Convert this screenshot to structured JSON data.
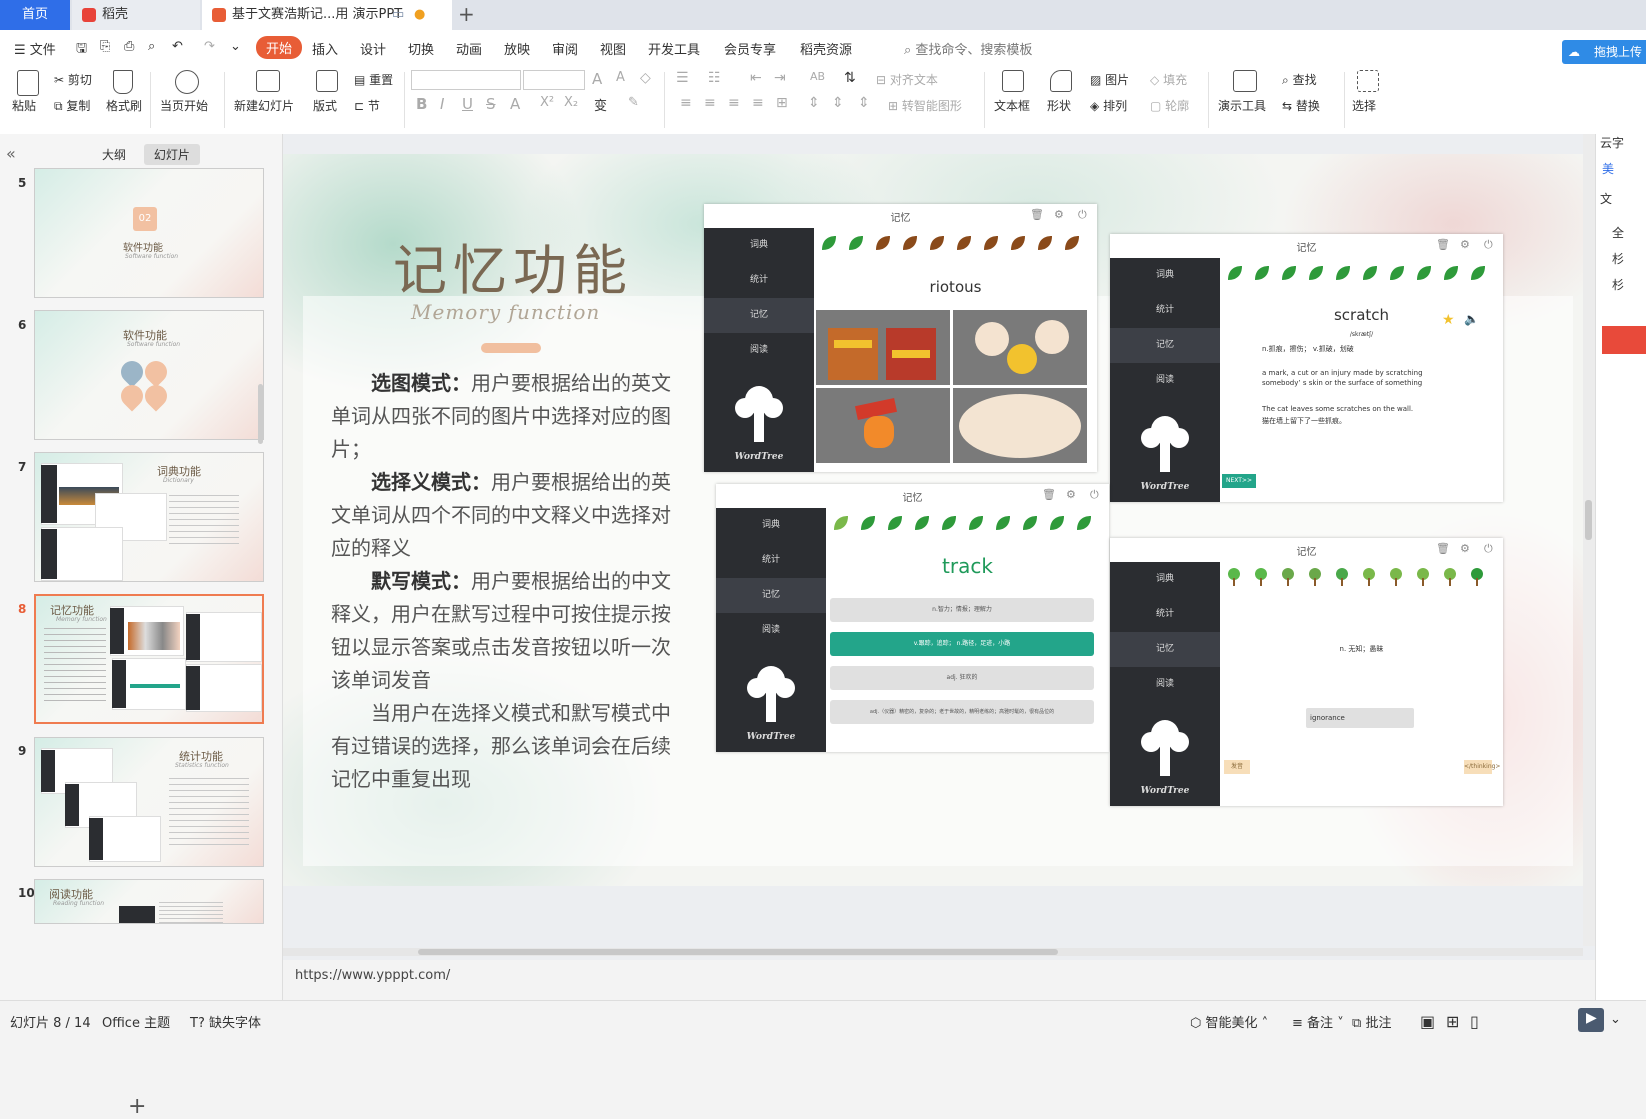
{
  "tabs": [
    {
      "label": "首页"
    },
    {
      "label": "稻壳"
    },
    {
      "label": "基于文赛浩斯记...用 演示PPT"
    }
  ],
  "menu": {
    "file": "文件",
    "items": [
      "开始",
      "插入",
      "设计",
      "切换",
      "动画",
      "放映",
      "审阅",
      "视图",
      "开发工具",
      "会员专享",
      "稻壳资源"
    ],
    "search": "查找命令、搜索模板",
    "cloud": "拖拽上传"
  },
  "ribbon": {
    "paste": "粘贴",
    "cut": "剪切",
    "copy": "复制",
    "format_painter": "格式刷",
    "from_current": "当页开始",
    "new_slide": "新建幻灯片",
    "layout": "版式",
    "reset": "重置",
    "section": "节",
    "align_text": "对齐文本",
    "smartart": "转智能图形",
    "textbox": "文本框",
    "shape": "形状",
    "picture": "图片",
    "arrange": "排列",
    "fill": "填充",
    "outline": "轮廓",
    "present_tools": "演示工具",
    "find": "查找",
    "replace": "替换",
    "select": "选择"
  },
  "leftpanel": {
    "tab_outline": "大纲",
    "tab_slides": "幻灯片",
    "thumbs": [
      {
        "num": "5",
        "title": "软件功能",
        "badge": "02",
        "sub": "Software function"
      },
      {
        "num": "6",
        "title": "软件功能",
        "sub": "Software function"
      },
      {
        "num": "7",
        "title": "词典功能",
        "sub": "Dictionary"
      },
      {
        "num": "8",
        "title": "记忆功能",
        "sub": "Memory function"
      },
      {
        "num": "9",
        "title": "统计功能",
        "sub": "Statistics function"
      },
      {
        "num": "10",
        "title": "阅读功能",
        "sub": "Reading function"
      }
    ]
  },
  "slide": {
    "title": "记忆功能",
    "subtitle": "Memory function",
    "para1_bold": "选图模式：",
    "para1": "用户要根据给出的英文单词从四张不同的图片中选择对应的图片；",
    "para2_bold": "选择义模式：",
    "para2": "用户要根据给出的英文单词从四个不同的中文释义中选择对应的释义",
    "para3_bold": "默写模式：",
    "para3": "用户要根据给出的中文释义，用户在默写过程中可按住提示按钮以显示答案或点击发音按钮以听一次该单词发音",
    "para4": "当用户在选择义模式和默写模式中有过错误的选择，那么该单词会在后续记忆中重复出现"
  },
  "app": {
    "window_title": "记忆",
    "side": [
      "词典",
      "统计",
      "记忆",
      "阅读"
    ],
    "logo": "WordTree",
    "win1": {
      "word": "riotous"
    },
    "win2": {
      "word": "scratch",
      "phonetic": "/skrætʃ/",
      "cn": "n.抓痕，擦伤；  v.抓破，划破",
      "en": "a mark, a cut or an injury made by scratching somebody’ s skin or the surface of something",
      "ex_en": "The cat leaves some scratches on the wall.",
      "ex_cn": "猫在墙上留下了一些抓痕。",
      "next": "NEXT>>"
    },
    "win3": {
      "word": "track",
      "options": [
        "n.智力；情报；理解力",
        "v.跟踪，追踪；  n.路径，足迹，小路",
        "adj. 狂欢的",
        "adj.（仪器）精密的，复杂的；老于世故的，精明老练的；高雅时髦的，很有品位的"
      ]
    },
    "win4": {
      "cn": "n. 无知；愚昧",
      "answer": "ignorance",
      "hint": "发音",
      "next": "</thinking>"
    }
  },
  "url": "https://www.ypppt.com/",
  "status": {
    "slide_counter": "幻灯片 8 / 14",
    "theme": "Office 主题",
    "missing_font": "缺失字体",
    "beautify": "智能美化",
    "notes": "备注",
    "comment": "批注"
  },
  "rightpanel": {
    "items": [
      "云字",
      "美",
      "文",
      "全",
      "杉",
      "杉"
    ]
  },
  "colors": {
    "accent": "#e85d36",
    "tab_active": "#2f6ee8",
    "option_selected": "#23a58a",
    "sidebar": "#2b2d31",
    "track_word": "#1f9a5a"
  }
}
